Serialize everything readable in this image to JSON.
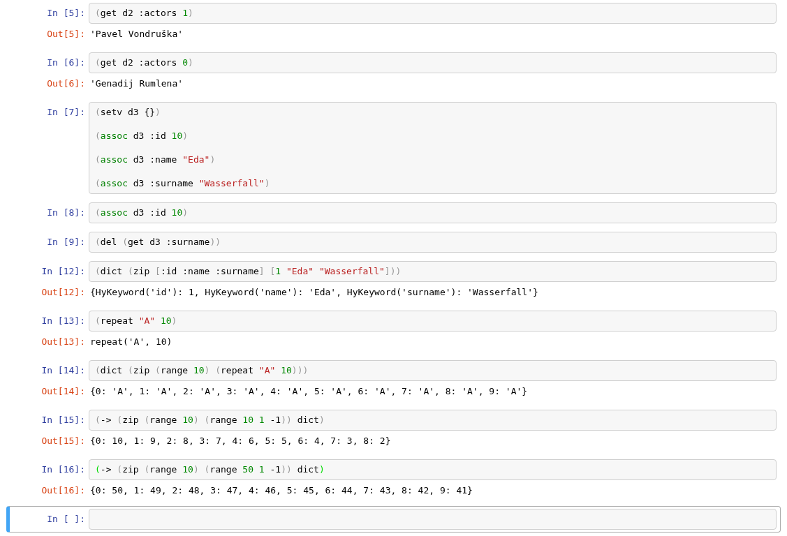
{
  "cells": [
    {
      "prompt": "In [5]:",
      "selected": false,
      "lines": [
        [
          {
            "text": "(",
            "kind": "paren"
          },
          {
            "text": "get d2 :actors ",
            "kind": "name"
          },
          {
            "text": "1",
            "kind": "number"
          },
          {
            "text": ")",
            "kind": "paren"
          }
        ]
      ],
      "output": {
        "prompt": "Out[5]:",
        "text": "'Pavel Vondruška'"
      }
    },
    {
      "prompt": "In [6]:",
      "selected": false,
      "lines": [
        [
          {
            "text": "(",
            "kind": "paren"
          },
          {
            "text": "get d2 :actors ",
            "kind": "name"
          },
          {
            "text": "0",
            "kind": "number"
          },
          {
            "text": ")",
            "kind": "paren"
          }
        ]
      ],
      "output": {
        "prompt": "Out[6]:",
        "text": "'Genadij Rumlena'"
      }
    },
    {
      "prompt": "In [7]:",
      "selected": false,
      "lines": [
        [
          {
            "text": "(",
            "kind": "paren"
          },
          {
            "text": "setv d3 {}",
            "kind": "name"
          },
          {
            "text": ")",
            "kind": "paren"
          }
        ],
        [
          {
            "text": "(",
            "kind": "paren"
          },
          {
            "text": "assoc",
            "kind": "keyword"
          },
          {
            "text": " d3 :id ",
            "kind": "name"
          },
          {
            "text": "10",
            "kind": "number"
          },
          {
            "text": ")",
            "kind": "paren"
          }
        ],
        [
          {
            "text": "(",
            "kind": "paren"
          },
          {
            "text": "assoc",
            "kind": "keyword"
          },
          {
            "text": " d3 :name ",
            "kind": "name"
          },
          {
            "text": "\"Eda\"",
            "kind": "string"
          },
          {
            "text": ")",
            "kind": "paren"
          }
        ],
        [
          {
            "text": "(",
            "kind": "paren"
          },
          {
            "text": "assoc",
            "kind": "keyword"
          },
          {
            "text": " d3 :surname ",
            "kind": "name"
          },
          {
            "text": "\"Wasserfall\"",
            "kind": "string"
          },
          {
            "text": ")",
            "kind": "paren"
          }
        ]
      ]
    },
    {
      "prompt": "In [8]:",
      "selected": false,
      "lines": [
        [
          {
            "text": "(",
            "kind": "paren"
          },
          {
            "text": "assoc",
            "kind": "keyword"
          },
          {
            "text": " d3 :id ",
            "kind": "name"
          },
          {
            "text": "10",
            "kind": "number"
          },
          {
            "text": ")",
            "kind": "paren"
          }
        ]
      ]
    },
    {
      "prompt": "In [9]:",
      "selected": false,
      "lines": [
        [
          {
            "text": "(",
            "kind": "paren"
          },
          {
            "text": "del ",
            "kind": "name"
          },
          {
            "text": "(",
            "kind": "paren"
          },
          {
            "text": "get d3 :surname",
            "kind": "name"
          },
          {
            "text": "))",
            "kind": "paren"
          }
        ]
      ]
    },
    {
      "prompt": "In [12]:",
      "selected": false,
      "lines": [
        [
          {
            "text": "(",
            "kind": "paren"
          },
          {
            "text": "dict ",
            "kind": "name"
          },
          {
            "text": "(",
            "kind": "paren"
          },
          {
            "text": "zip ",
            "kind": "name"
          },
          {
            "text": "[",
            "kind": "paren"
          },
          {
            "text": ":id :name :surname",
            "kind": "name"
          },
          {
            "text": "] [",
            "kind": "paren"
          },
          {
            "text": "1 ",
            "kind": "number"
          },
          {
            "text": "\"Eda\" \"Wasserfall\"",
            "kind": "string"
          },
          {
            "text": "]))",
            "kind": "paren"
          }
        ]
      ],
      "output": {
        "prompt": "Out[12]:",
        "text": "{HyKeyword('id'): 1, HyKeyword('name'): 'Eda', HyKeyword('surname'): 'Wasserfall'}"
      }
    },
    {
      "prompt": "In [13]:",
      "selected": false,
      "lines": [
        [
          {
            "text": "(",
            "kind": "paren"
          },
          {
            "text": "repeat ",
            "kind": "name"
          },
          {
            "text": "\"A\" ",
            "kind": "string"
          },
          {
            "text": "10",
            "kind": "number"
          },
          {
            "text": ")",
            "kind": "paren"
          }
        ]
      ],
      "output": {
        "prompt": "Out[13]:",
        "text": "repeat('A', 10)"
      }
    },
    {
      "prompt": "In [14]:",
      "selected": false,
      "lines": [
        [
          {
            "text": "(",
            "kind": "paren"
          },
          {
            "text": "dict ",
            "kind": "name"
          },
          {
            "text": "(",
            "kind": "paren"
          },
          {
            "text": "zip ",
            "kind": "name"
          },
          {
            "text": "(",
            "kind": "paren"
          },
          {
            "text": "range ",
            "kind": "name"
          },
          {
            "text": "10",
            "kind": "number"
          },
          {
            "text": ") (",
            "kind": "paren"
          },
          {
            "text": "repeat ",
            "kind": "name"
          },
          {
            "text": "\"A\" ",
            "kind": "string"
          },
          {
            "text": "10",
            "kind": "number"
          },
          {
            "text": ")))",
            "kind": "paren"
          }
        ]
      ],
      "output": {
        "prompt": "Out[14]:",
        "text": "{0: 'A', 1: 'A', 2: 'A', 3: 'A', 4: 'A', 5: 'A', 6: 'A', 7: 'A', 8: 'A', 9: 'A'}"
      }
    },
    {
      "prompt": "In [15]:",
      "selected": false,
      "lines": [
        [
          {
            "text": "(",
            "kind": "paren"
          },
          {
            "text": "-> ",
            "kind": "name"
          },
          {
            "text": "(",
            "kind": "paren"
          },
          {
            "text": "zip ",
            "kind": "name"
          },
          {
            "text": "(",
            "kind": "paren"
          },
          {
            "text": "range ",
            "kind": "name"
          },
          {
            "text": "10",
            "kind": "number"
          },
          {
            "text": ") (",
            "kind": "paren"
          },
          {
            "text": "range ",
            "kind": "name"
          },
          {
            "text": "10 1",
            "kind": "number"
          },
          {
            "text": " -1",
            "kind": "name"
          },
          {
            "text": ")) ",
            "kind": "paren"
          },
          {
            "text": "dict",
            "kind": "name"
          },
          {
            "text": ")",
            "kind": "paren"
          }
        ]
      ],
      "output": {
        "prompt": "Out[15]:",
        "text": "{0: 10, 1: 9, 2: 8, 3: 7, 4: 6, 5: 5, 6: 4, 7: 3, 8: 2}"
      }
    },
    {
      "prompt": "In [16]:",
      "selected": false,
      "lines": [
        [
          {
            "text": "(",
            "kind": "match"
          },
          {
            "text": "-> ",
            "kind": "name"
          },
          {
            "text": "(",
            "kind": "paren"
          },
          {
            "text": "zip ",
            "kind": "name"
          },
          {
            "text": "(",
            "kind": "paren"
          },
          {
            "text": "range ",
            "kind": "name"
          },
          {
            "text": "10",
            "kind": "number"
          },
          {
            "text": ") (",
            "kind": "paren"
          },
          {
            "text": "range ",
            "kind": "name"
          },
          {
            "text": "50 1",
            "kind": "number"
          },
          {
            "text": " -1",
            "kind": "name"
          },
          {
            "text": ")) ",
            "kind": "paren"
          },
          {
            "text": "dict",
            "kind": "name"
          },
          {
            "text": ")",
            "kind": "match"
          }
        ]
      ],
      "output": {
        "prompt": "Out[16]:",
        "text": "{0: 50, 1: 49, 2: 48, 3: 47, 4: 46, 5: 45, 6: 44, 7: 43, 8: 42, 9: 41}"
      }
    },
    {
      "prompt": "In [ ]:",
      "selected": true
    }
  ]
}
